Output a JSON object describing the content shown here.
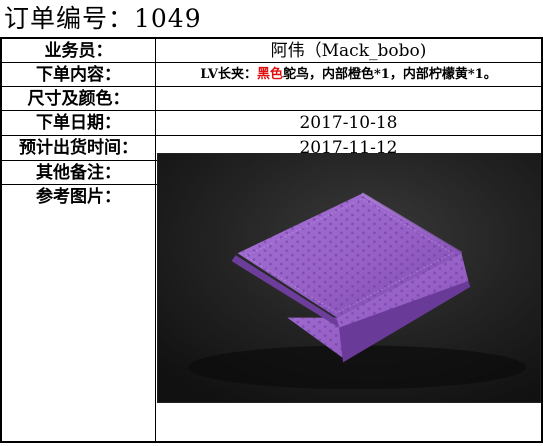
{
  "order": {
    "title": "订单编号：1049"
  },
  "rows": [
    {
      "label": "业务员：",
      "value": "阿伟（Mack_bobo)"
    },
    {
      "label": "下单内容：",
      "value_pre": "LV长夹：",
      "value_highlight": "黑色",
      "value_post": "鸵鸟，内部橙色*1，内部柠檬黄*1。"
    },
    {
      "label": "尺寸及颜色：",
      "value": ""
    },
    {
      "label": "下单日期：",
      "value": "2017-10-18"
    },
    {
      "label": "预计出货时间：",
      "value": "2017-11-12"
    },
    {
      "label": "其他备注：",
      "value": ""
    },
    {
      "label": "参考图片："
    }
  ],
  "colors": {
    "highlight": "#e01010",
    "wallet_purple": "#9b63c8",
    "background": "#1c1c1c"
  },
  "image": {
    "subject": "purple ostrich leather long wallet on dark surface",
    "icon": "wallet-photo"
  }
}
